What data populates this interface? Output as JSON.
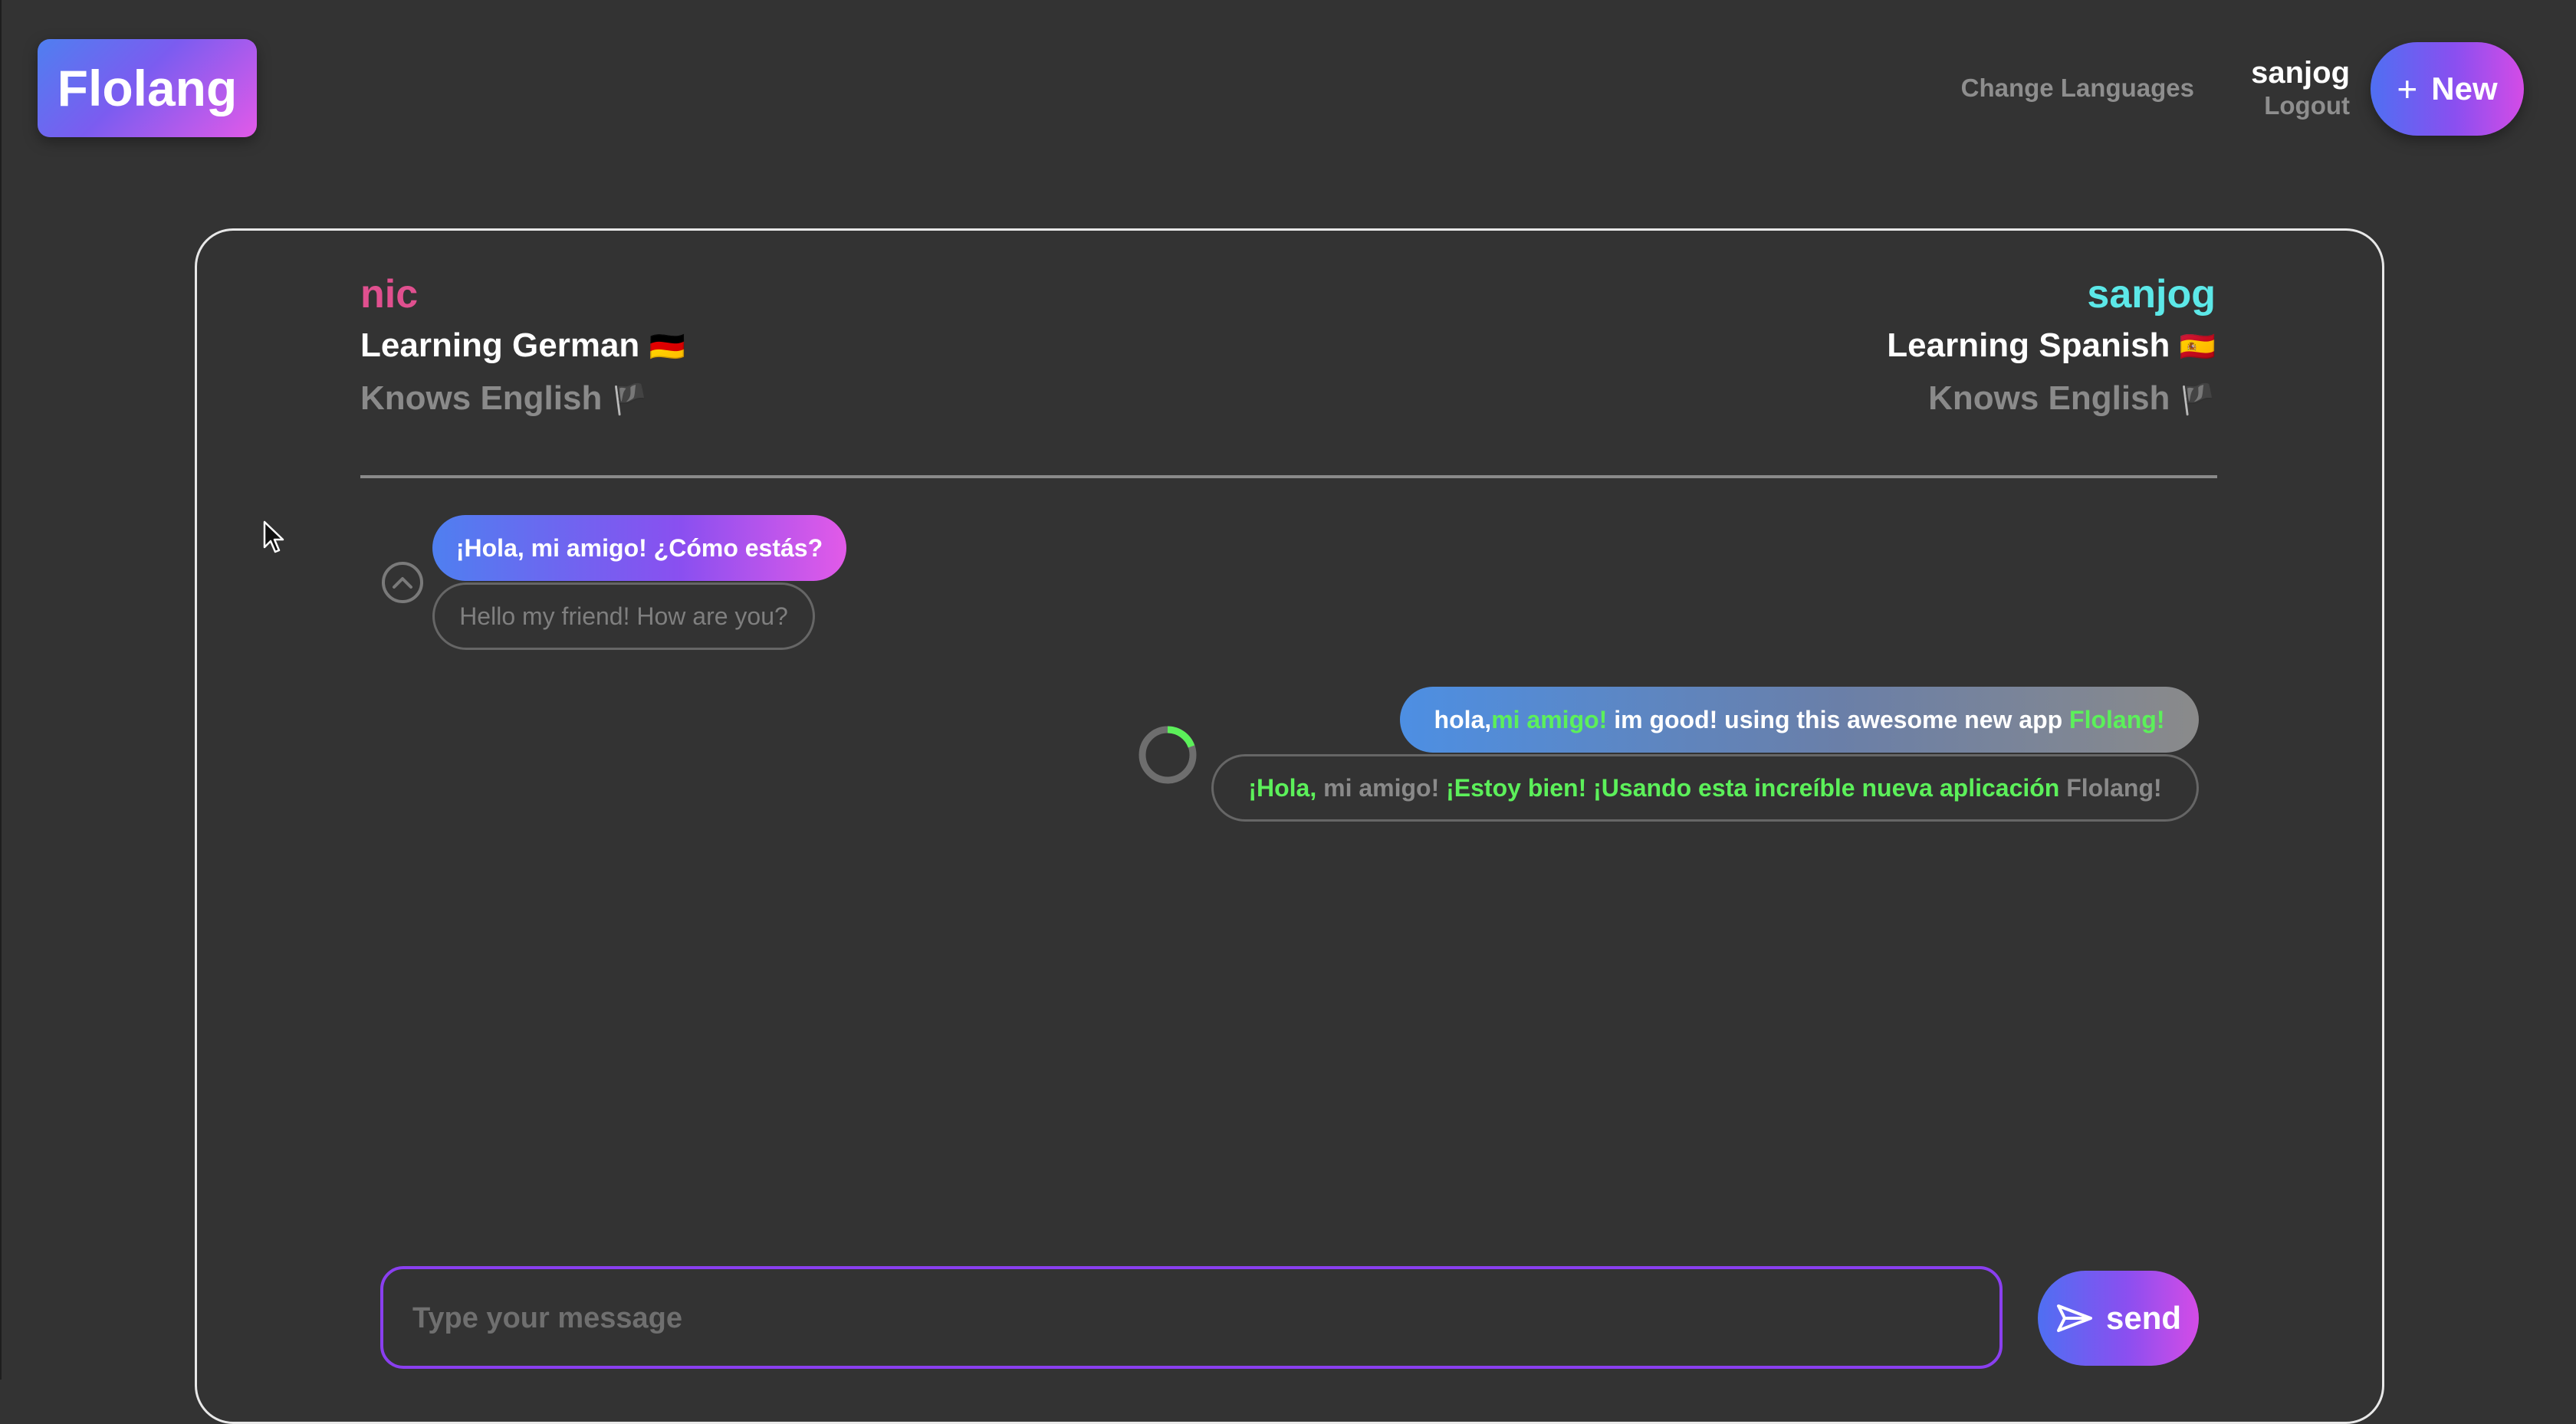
{
  "app": {
    "logo": "Flolang"
  },
  "header": {
    "change_languages": "Change Languages",
    "username": "sanjog",
    "logout": "Logout",
    "new_label": "New",
    "new_icon": "plus-icon"
  },
  "profiles": {
    "left": {
      "name": "nic",
      "name_color": "#e0508f",
      "learning": "Learning German",
      "learning_flag": "🇩🇪",
      "knows": "Knows English",
      "knows_flag": "🏴"
    },
    "right": {
      "name": "sanjog",
      "name_color": "#5ce8e8",
      "learning": "Learning Spanish",
      "learning_flag": "🇪🇸",
      "knows": "Knows English",
      "knows_flag": "🏴"
    }
  },
  "messages": {
    "first": {
      "original": "¡Hola, mi amigo! ¿Cómo estás?",
      "translation": "Hello my friend! How are you?",
      "collapse_icon": "chevron-up-icon"
    },
    "second": {
      "original_parts": [
        {
          "text": "hola, ",
          "tone": "white"
        },
        {
          "text": "mi amigo!",
          "tone": "green"
        },
        {
          "text": " im good! using this awesome new app ",
          "tone": "white"
        },
        {
          "text": "Flolang!",
          "tone": "green"
        }
      ],
      "translation_parts": [
        {
          "text": "¡Hola,",
          "tone": "green"
        },
        {
          "text": " mi amigo! ",
          "tone": "grey"
        },
        {
          "text": "¡Estoy bien! ¡Usando esta increíble nueva aplicación",
          "tone": "green"
        },
        {
          "text": " Flolang!",
          "tone": "grey"
        }
      ],
      "status_icon": "loading-spinner-icon"
    }
  },
  "composer": {
    "placeholder": "Type your message",
    "value": "",
    "send_label": "send",
    "send_icon": "paper-plane-icon"
  },
  "colors": {
    "accent_green": "#5cf05a",
    "accent_purple": "#8a3ff0",
    "background": "#333333"
  }
}
